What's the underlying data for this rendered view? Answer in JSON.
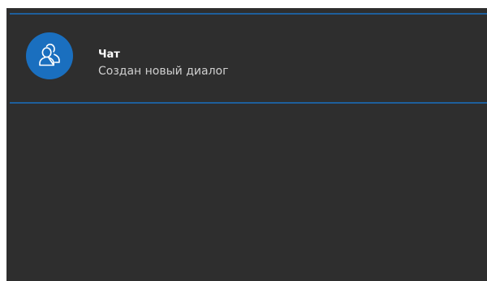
{
  "notification": {
    "title": "Чат",
    "message": "Создан новый диалог",
    "icon": "group-users-icon"
  },
  "colors": {
    "panel_background": "#2e2e2e",
    "accent": "#1a6fbf",
    "divider": "#1e5f9c",
    "title_text": "#ffffff",
    "message_text": "#cfcfcf"
  }
}
